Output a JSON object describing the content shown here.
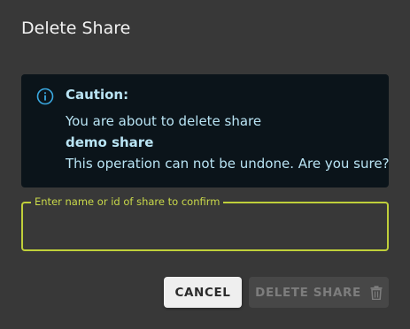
{
  "dialog": {
    "title": "Delete Share"
  },
  "alert": {
    "icon": "info-circle-icon",
    "heading": "Caution:",
    "line1": "You are about to delete share",
    "share_name": "demo share",
    "line3": "This operation can not be undone. Are you sure?",
    "color": "#b9e4f4",
    "background": "#0b141a"
  },
  "confirm_field": {
    "label": "Enter name or id of share to confirm",
    "value": "",
    "accent": "#bfcf3a"
  },
  "actions": {
    "cancel_label": "CANCEL",
    "delete_label": "DELETE SHARE",
    "delete_icon": "trash-icon",
    "delete_disabled": true
  }
}
